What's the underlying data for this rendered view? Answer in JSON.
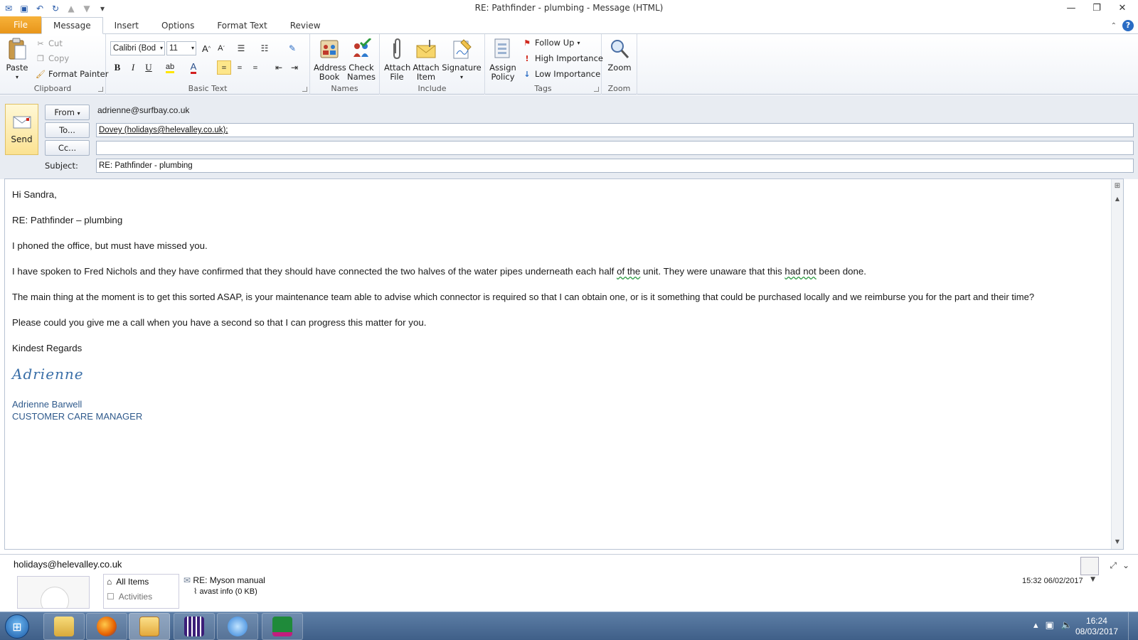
{
  "window": {
    "title": "RE: Pathfinder - plumbing  -  Message (HTML)"
  },
  "tabs": [
    "File",
    "Message",
    "Insert",
    "Options",
    "Format Text",
    "Review"
  ],
  "ribbon": {
    "clipboard": {
      "label": "Clipboard",
      "paste": "Paste",
      "cut": "Cut",
      "copy": "Copy",
      "format_painter": "Format Painter"
    },
    "basic_text": {
      "label": "Basic Text",
      "font": "Calibri (Body)",
      "size": "11",
      "bold": "B",
      "italic": "I",
      "underline": "U",
      "font_color": "A"
    },
    "names": {
      "label": "Names",
      "address_book": "Address Book",
      "check_names": "Check Names"
    },
    "include": {
      "label": "Include",
      "attach_file": "Attach File",
      "attach_item": "Attach Item",
      "signature": "Signature"
    },
    "tags": {
      "label": "Tags",
      "assign_policy": "Assign Policy",
      "follow_up": "Follow Up",
      "high_importance": "High Importance",
      "low_importance": "Low Importance"
    },
    "zoom": {
      "label": "Zoom",
      "zoom": "Zoom"
    }
  },
  "header": {
    "send": "Send",
    "from_button": "From",
    "from_value": "adrienne@surfbay.co.uk",
    "to_button": "To...",
    "to_value": "Dovey (holidays@helevalley.co.uk);",
    "cc_button": "Cc...",
    "cc_value": "",
    "subject_label": "Subject:",
    "subject_value": "RE: Pathfinder - plumbing"
  },
  "body": {
    "greeting": "Hi Sandra,",
    "re_line": "RE: Pathfinder – plumbing",
    "p1": "I phoned the office, but must have missed you.",
    "p2a": "I have spoken to Fred Nichols and they have confirmed that they should have connected the two halves of the water pipes underneath each half ",
    "p2b": "of  the",
    "p2c": " unit.  They were unaware that this ",
    "p2d": "had  not",
    "p2e": " been done.",
    "p3": "The main thing at the moment is to get this sorted ASAP,  is your maintenance team able to advise which connector is required so that I can obtain one, or is it something that could be purchased locally and we reimburse you for the part and their time?",
    "p4": "Please could you give me a call when you have a second so that I can progress this matter for you.",
    "closing": "Kindest Regards",
    "signature_script": "Adrienne",
    "sig_name": "Adrienne Barwell",
    "sig_title": "CUSTOMER CARE MANAGER"
  },
  "people_pane": {
    "email": "holidays@helevalley.co.uk",
    "category_all": "All Items",
    "category_next": "Activities",
    "item_subject": "RE: Myson manual",
    "item_attachment": "avast info (0 KB)",
    "item_time": "15:32  06/02/2017"
  },
  "taskbar": {
    "time": "16:24",
    "date": "08/03/2017"
  },
  "colors": {
    "file_tab": "#e8951a",
    "accent_blue": "#2a5caa",
    "signature_blue": "#2f5a8c",
    "taskbar": "#4a6b94"
  }
}
